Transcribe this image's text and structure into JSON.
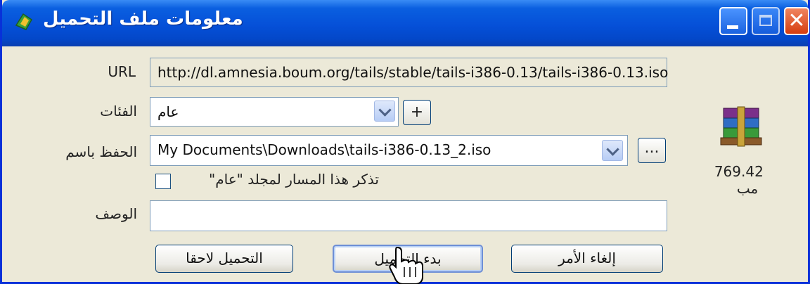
{
  "window": {
    "title": "معلومات ملف التحميل"
  },
  "url": {
    "label": "URL",
    "value": "http://dl.amnesia.boum.org/tails/stable/tails-i386-0.13/tails-i386-0.13.iso"
  },
  "category": {
    "label": "الفئات",
    "value": "عام",
    "add_button": "+"
  },
  "save_as": {
    "label": "الحفظ باسم",
    "value": "My Documents\\Downloads\\tails-i386-0.13_2.iso",
    "browse_button": "..."
  },
  "remember": {
    "label": "تذكر هذا المسار لمجلد \"عام\"",
    "checked": false
  },
  "description": {
    "label": "الوصف",
    "value": ""
  },
  "file": {
    "size": "769.42",
    "size_unit": "مب",
    "icon": "winrar-archive-icon"
  },
  "buttons": {
    "download_later": "التحميل لاحقا",
    "start_download": "بدء التحميل",
    "cancel": "إلغاء الأمر"
  },
  "colors": {
    "titlebar": "#0550d8",
    "window_bg": "#ece9d8",
    "close": "#d63d10"
  }
}
